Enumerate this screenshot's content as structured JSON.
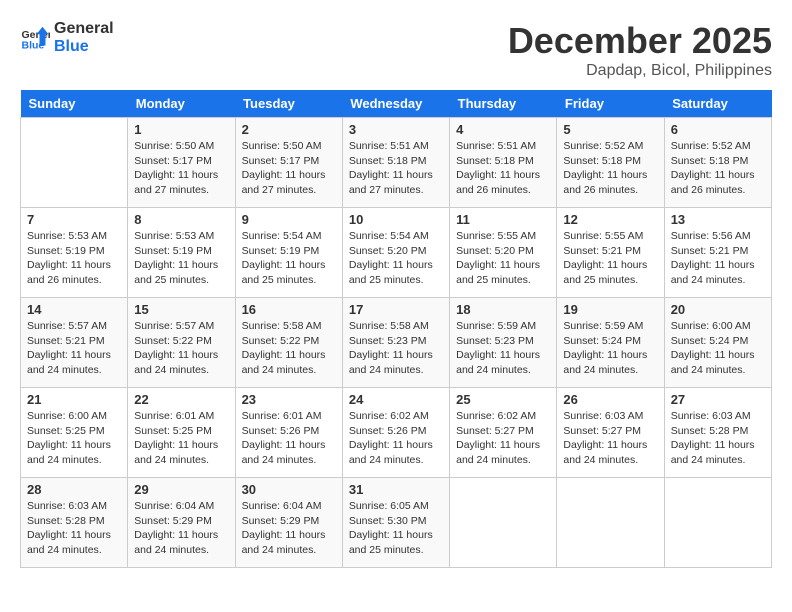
{
  "logo": {
    "line1": "General",
    "line2": "Blue"
  },
  "title": "December 2025",
  "location": "Dapdap, Bicol, Philippines",
  "days_of_week": [
    "Sunday",
    "Monday",
    "Tuesday",
    "Wednesday",
    "Thursday",
    "Friday",
    "Saturday"
  ],
  "weeks": [
    [
      {
        "day": "",
        "sunrise": "",
        "sunset": "",
        "daylight": ""
      },
      {
        "day": "1",
        "sunrise": "Sunrise: 5:50 AM",
        "sunset": "Sunset: 5:17 PM",
        "daylight": "Daylight: 11 hours and 27 minutes."
      },
      {
        "day": "2",
        "sunrise": "Sunrise: 5:50 AM",
        "sunset": "Sunset: 5:17 PM",
        "daylight": "Daylight: 11 hours and 27 minutes."
      },
      {
        "day": "3",
        "sunrise": "Sunrise: 5:51 AM",
        "sunset": "Sunset: 5:18 PM",
        "daylight": "Daylight: 11 hours and 27 minutes."
      },
      {
        "day": "4",
        "sunrise": "Sunrise: 5:51 AM",
        "sunset": "Sunset: 5:18 PM",
        "daylight": "Daylight: 11 hours and 26 minutes."
      },
      {
        "day": "5",
        "sunrise": "Sunrise: 5:52 AM",
        "sunset": "Sunset: 5:18 PM",
        "daylight": "Daylight: 11 hours and 26 minutes."
      },
      {
        "day": "6",
        "sunrise": "Sunrise: 5:52 AM",
        "sunset": "Sunset: 5:18 PM",
        "daylight": "Daylight: 11 hours and 26 minutes."
      }
    ],
    [
      {
        "day": "7",
        "sunrise": "Sunrise: 5:53 AM",
        "sunset": "Sunset: 5:19 PM",
        "daylight": "Daylight: 11 hours and 26 minutes."
      },
      {
        "day": "8",
        "sunrise": "Sunrise: 5:53 AM",
        "sunset": "Sunset: 5:19 PM",
        "daylight": "Daylight: 11 hours and 25 minutes."
      },
      {
        "day": "9",
        "sunrise": "Sunrise: 5:54 AM",
        "sunset": "Sunset: 5:19 PM",
        "daylight": "Daylight: 11 hours and 25 minutes."
      },
      {
        "day": "10",
        "sunrise": "Sunrise: 5:54 AM",
        "sunset": "Sunset: 5:20 PM",
        "daylight": "Daylight: 11 hours and 25 minutes."
      },
      {
        "day": "11",
        "sunrise": "Sunrise: 5:55 AM",
        "sunset": "Sunset: 5:20 PM",
        "daylight": "Daylight: 11 hours and 25 minutes."
      },
      {
        "day": "12",
        "sunrise": "Sunrise: 5:55 AM",
        "sunset": "Sunset: 5:21 PM",
        "daylight": "Daylight: 11 hours and 25 minutes."
      },
      {
        "day": "13",
        "sunrise": "Sunrise: 5:56 AM",
        "sunset": "Sunset: 5:21 PM",
        "daylight": "Daylight: 11 hours and 24 minutes."
      }
    ],
    [
      {
        "day": "14",
        "sunrise": "Sunrise: 5:57 AM",
        "sunset": "Sunset: 5:21 PM",
        "daylight": "Daylight: 11 hours and 24 minutes."
      },
      {
        "day": "15",
        "sunrise": "Sunrise: 5:57 AM",
        "sunset": "Sunset: 5:22 PM",
        "daylight": "Daylight: 11 hours and 24 minutes."
      },
      {
        "day": "16",
        "sunrise": "Sunrise: 5:58 AM",
        "sunset": "Sunset: 5:22 PM",
        "daylight": "Daylight: 11 hours and 24 minutes."
      },
      {
        "day": "17",
        "sunrise": "Sunrise: 5:58 AM",
        "sunset": "Sunset: 5:23 PM",
        "daylight": "Daylight: 11 hours and 24 minutes."
      },
      {
        "day": "18",
        "sunrise": "Sunrise: 5:59 AM",
        "sunset": "Sunset: 5:23 PM",
        "daylight": "Daylight: 11 hours and 24 minutes."
      },
      {
        "day": "19",
        "sunrise": "Sunrise: 5:59 AM",
        "sunset": "Sunset: 5:24 PM",
        "daylight": "Daylight: 11 hours and 24 minutes."
      },
      {
        "day": "20",
        "sunrise": "Sunrise: 6:00 AM",
        "sunset": "Sunset: 5:24 PM",
        "daylight": "Daylight: 11 hours and 24 minutes."
      }
    ],
    [
      {
        "day": "21",
        "sunrise": "Sunrise: 6:00 AM",
        "sunset": "Sunset: 5:25 PM",
        "daylight": "Daylight: 11 hours and 24 minutes."
      },
      {
        "day": "22",
        "sunrise": "Sunrise: 6:01 AM",
        "sunset": "Sunset: 5:25 PM",
        "daylight": "Daylight: 11 hours and 24 minutes."
      },
      {
        "day": "23",
        "sunrise": "Sunrise: 6:01 AM",
        "sunset": "Sunset: 5:26 PM",
        "daylight": "Daylight: 11 hours and 24 minutes."
      },
      {
        "day": "24",
        "sunrise": "Sunrise: 6:02 AM",
        "sunset": "Sunset: 5:26 PM",
        "daylight": "Daylight: 11 hours and 24 minutes."
      },
      {
        "day": "25",
        "sunrise": "Sunrise: 6:02 AM",
        "sunset": "Sunset: 5:27 PM",
        "daylight": "Daylight: 11 hours and 24 minutes."
      },
      {
        "day": "26",
        "sunrise": "Sunrise: 6:03 AM",
        "sunset": "Sunset: 5:27 PM",
        "daylight": "Daylight: 11 hours and 24 minutes."
      },
      {
        "day": "27",
        "sunrise": "Sunrise: 6:03 AM",
        "sunset": "Sunset: 5:28 PM",
        "daylight": "Daylight: 11 hours and 24 minutes."
      }
    ],
    [
      {
        "day": "28",
        "sunrise": "Sunrise: 6:03 AM",
        "sunset": "Sunset: 5:28 PM",
        "daylight": "Daylight: 11 hours and 24 minutes."
      },
      {
        "day": "29",
        "sunrise": "Sunrise: 6:04 AM",
        "sunset": "Sunset: 5:29 PM",
        "daylight": "Daylight: 11 hours and 24 minutes."
      },
      {
        "day": "30",
        "sunrise": "Sunrise: 6:04 AM",
        "sunset": "Sunset: 5:29 PM",
        "daylight": "Daylight: 11 hours and 24 minutes."
      },
      {
        "day": "31",
        "sunrise": "Sunrise: 6:05 AM",
        "sunset": "Sunset: 5:30 PM",
        "daylight": "Daylight: 11 hours and 25 minutes."
      },
      {
        "day": "",
        "sunrise": "",
        "sunset": "",
        "daylight": ""
      },
      {
        "day": "",
        "sunrise": "",
        "sunset": "",
        "daylight": ""
      },
      {
        "day": "",
        "sunrise": "",
        "sunset": "",
        "daylight": ""
      }
    ]
  ]
}
